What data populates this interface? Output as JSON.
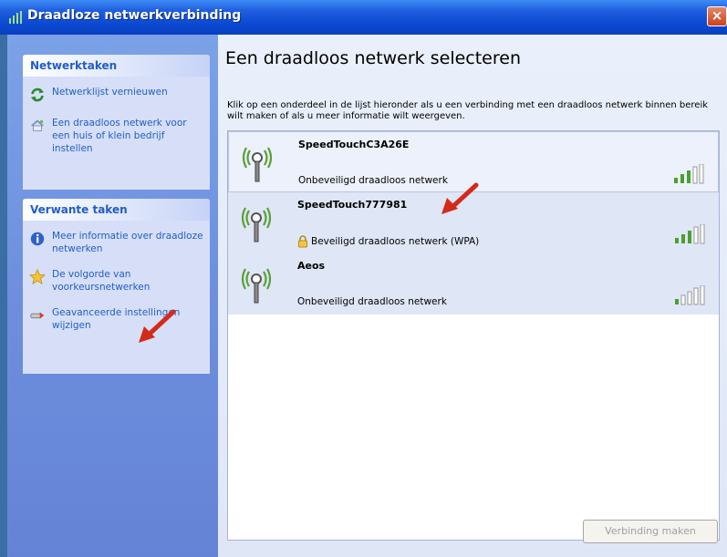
{
  "window": {
    "title": "Draadloze netwerkverbinding",
    "close_label": "×"
  },
  "sidebar": {
    "network_tasks": {
      "header": "Netwerktaken",
      "items": [
        {
          "label": "Netwerklijst vernieuwen",
          "icon": "refresh-icon"
        },
        {
          "label": "Een draadloos netwerk voor een huis of klein bedrijf instellen",
          "icon": "home-network-icon"
        }
      ]
    },
    "related_tasks": {
      "header": "Verwante taken",
      "items": [
        {
          "label": "Meer informatie over draadloze netwerken",
          "icon": "info-icon"
        },
        {
          "label": "De volgorde van voorkeursnetwerken",
          "icon": "star-icon"
        },
        {
          "label": "Geavanceerde instellingen wijzigen",
          "icon": "settings-icon"
        }
      ]
    }
  },
  "main": {
    "title": "Een draadloos netwerk selecteren",
    "description": "Klik op een onderdeel in de lijst hieronder als u een verbinding met een draadloos netwerk binnen bereik wilt maken of als u meer informatie wilt weergeven.",
    "networks": [
      {
        "name": "SpeedTouchC3A26E",
        "status": "Onbeveiligd draadloos netwerk",
        "secured": false,
        "signal_bars": 3
      },
      {
        "name": "SpeedTouch777981",
        "status": "Beveiligd draadloos netwerk (WPA)",
        "secured": true,
        "signal_bars": 3
      },
      {
        "name": "Aeos",
        "status": "Onbeveiligd draadloos netwerk",
        "secured": false,
        "signal_bars": 1
      }
    ],
    "connect_button": "Verbinding maken"
  },
  "colors": {
    "titlebar": "#0b49d2",
    "link": "#215dc6",
    "signal_green": "#4aa02c",
    "arrow": "#d42a1a"
  }
}
